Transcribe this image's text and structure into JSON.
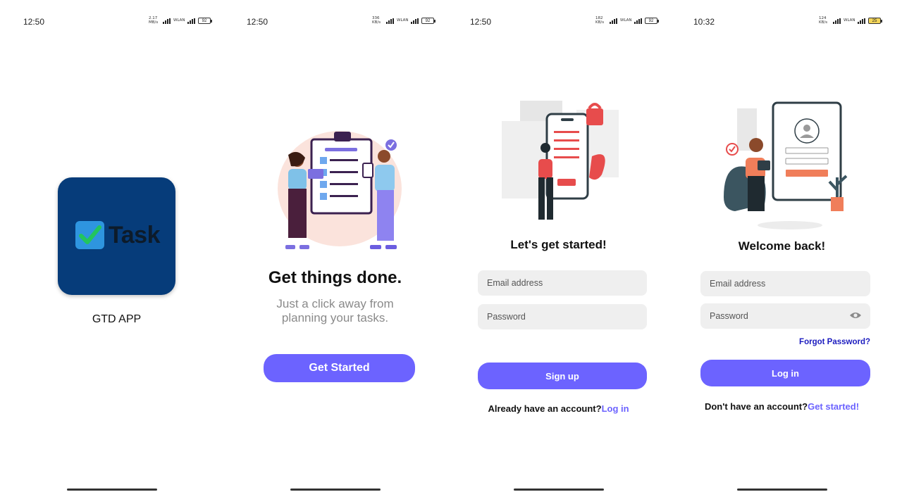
{
  "screens": [
    {
      "status": {
        "time": "12:50",
        "speed": "2.17 MB/s",
        "network": "WLAN",
        "battery": "92"
      },
      "app_icon": {
        "logo_text": "Task"
      },
      "app_name": "GTD APP"
    },
    {
      "status": {
        "time": "12:50",
        "speed": "336 KB/s",
        "network": "WLAN",
        "battery": "92"
      },
      "title": "Get things done.",
      "subtitle_line1": "Just a click away from",
      "subtitle_line2": "planning your tasks.",
      "cta_label": "Get Started"
    },
    {
      "status": {
        "time": "12:50",
        "speed": "182 KB/s",
        "network": "WLAN",
        "battery": "92"
      },
      "title": "Let's get started!",
      "email_placeholder": "Email address",
      "password_placeholder": "Password",
      "signup_label": "Sign up",
      "footer_prompt": "Already have an account?",
      "footer_link": "Log in"
    },
    {
      "status": {
        "time": "10:32",
        "speed": "124 KB/s",
        "network": "WLAN",
        "battery": "25"
      },
      "title": "Welcome back!",
      "email_placeholder": "Email address",
      "password_placeholder": "Password",
      "forgot_label": "Forgot Password?",
      "login_label": "Log in",
      "footer_prompt": "Don't have an account?",
      "footer_link": "Get started!"
    }
  ],
  "colors": {
    "accent": "#6c63ff",
    "app_icon_bg": "#063c7a",
    "check_blue": "#2e95df",
    "check_green": "#22c55e",
    "forgot_link": "#1b1bbf",
    "input_bg": "#efefef"
  },
  "icons": [
    "check-icon",
    "eye-icon",
    "signal-icon",
    "battery-icon"
  ]
}
